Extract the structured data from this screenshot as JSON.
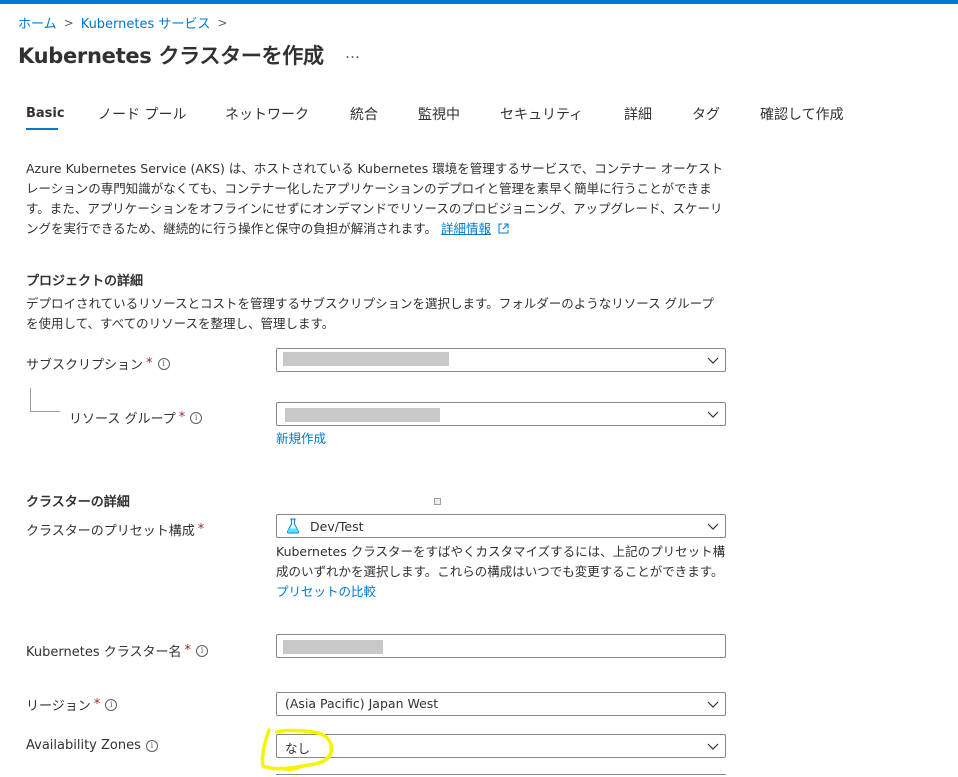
{
  "breadcrumb": {
    "home": "ホーム",
    "service": "Kubernetes サービス",
    "sep": ">"
  },
  "title": "Kubernetes クラスターを作成",
  "more": "…",
  "tabs": [
    "Basic",
    "ノード プール",
    "ネットワーク",
    "統合",
    "監視中",
    "セキュリティ",
    "詳細",
    "タグ",
    "確認して作成"
  ],
  "description": {
    "text": "Azure Kubernetes Service (AKS) は、ホストされている Kubernetes 環境を管理するサービスで、コンテナー オーケストレーションの専門知識がなくても、コンテナー化したアプリケーションのデプロイと管理を素早く簡単に行うことができます。また、アプリケーションをオフラインにせずにオンデマンドでリソースのプロビジョニング、アップグレード、スケーリングを実行できるため、継続的に行う操作と保守の負担が解消されます。",
    "link": "詳細情報"
  },
  "project": {
    "heading": "プロジェクトの詳細",
    "text": "デプロイされているリソースとコストを管理するサブスクリプションを選択します。フォルダーのようなリソース グループを使用して、すべてのリソースを整理し、管理します。",
    "subscription_label": "サブスクリプション",
    "resource_group_label": "リソース グループ",
    "create_new": "新規作成"
  },
  "cluster": {
    "heading": "クラスターの詳細",
    "preset_label": "クラスターのプリセット構成",
    "preset_value": "Dev/Test",
    "preset_help": "Kubernetes クラスターをすばやくカスタマイズするには、上記のプリセット構成のいずれかを選択します。これらの構成はいつでも変更することができます。",
    "preset_link": "プリセットの比較",
    "name_label": "Kubernetes クラスター名",
    "region_label": "リージョン",
    "region_value": "(Asia Pacific) Japan West",
    "zones_label": "Availability Zones",
    "zones_value": "なし"
  },
  "symbols": {
    "required": "*",
    "info": "i"
  },
  "colors": {
    "accent": "#0078d4",
    "required": "#a4262c",
    "highlight": "#f5f500",
    "redaction": "#c8c8c8"
  }
}
